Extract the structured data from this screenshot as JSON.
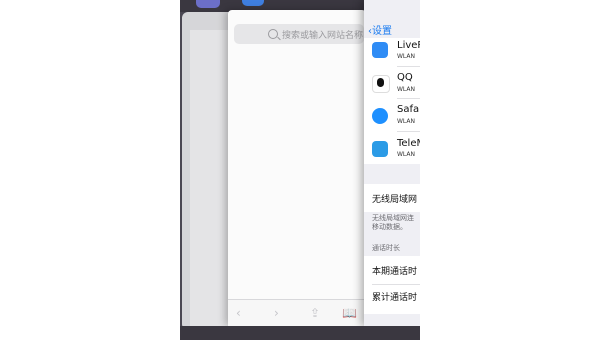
{
  "safari": {
    "search_placeholder": "搜索或输入网站名称",
    "toolbar": {
      "back_icon": "‹",
      "forward_icon": "›",
      "share_icon": "⇪",
      "bookmarks_icon": "📖"
    }
  },
  "settings": {
    "back_label": "设置",
    "apps": [
      {
        "title": "LiveP",
        "sub": "WLAN",
        "color": "#2f8cf5"
      },
      {
        "title": "QQ",
        "sub": "WLAN",
        "color": "#ffffff"
      },
      {
        "title": "Safar",
        "sub": "WLAN",
        "color": "#1e90ff"
      },
      {
        "title": "TeleM",
        "sub": "WLAN",
        "color": "#2b9be6"
      }
    ],
    "wlan_assist": "无线局域网",
    "wlan_note_line1": "无线局域网连",
    "wlan_note_line2": "移动数据。",
    "call_header": "通话时长",
    "current_period": "本期通话时",
    "lifetime": "累计通话时"
  }
}
